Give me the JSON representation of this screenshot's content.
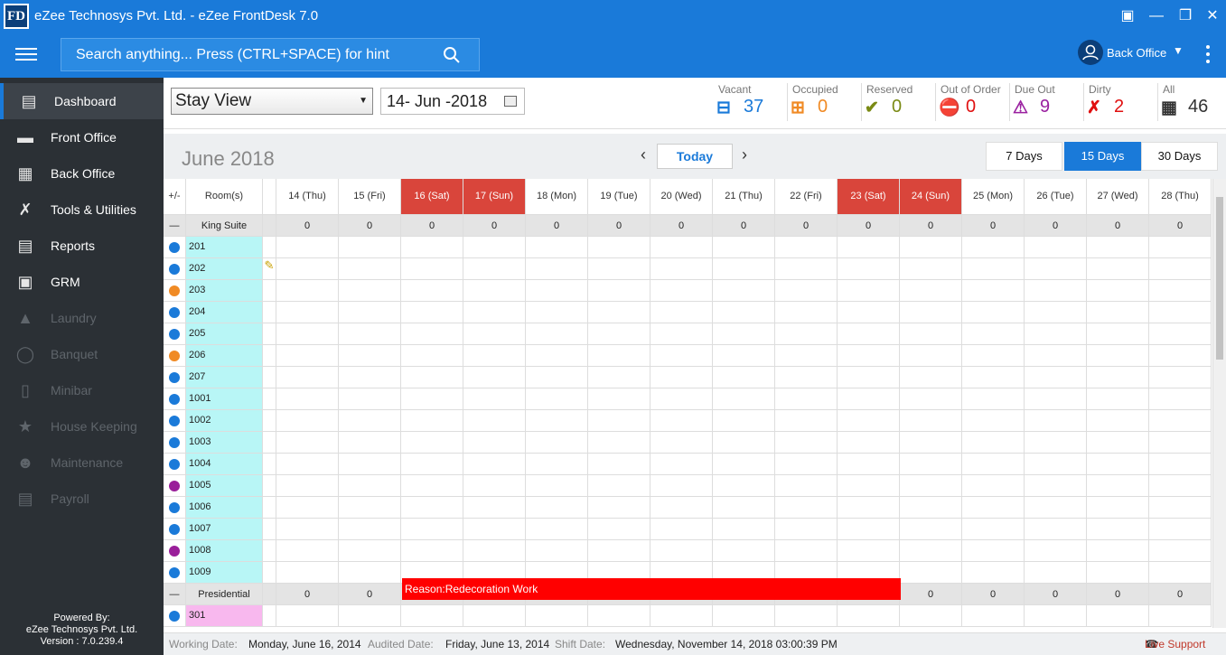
{
  "app": {
    "logo": "FD",
    "title": "eZee Technosys Pvt. Ltd. - eZee FrontDesk 7.0"
  },
  "search": {
    "placeholder": "Search anything... Press (CTRL+SPACE) for hint"
  },
  "user": {
    "name": "Back Office"
  },
  "sidebar": {
    "items": [
      {
        "label": "Dashboard",
        "icon": "chart-icon"
      },
      {
        "label": "Front Office",
        "icon": "bed-icon"
      },
      {
        "label": "Back Office",
        "icon": "building-icon"
      },
      {
        "label": "Tools & Utilities",
        "icon": "tools-icon"
      },
      {
        "label": "Reports",
        "icon": "report-icon"
      },
      {
        "label": "GRM",
        "icon": "grm-icon"
      },
      {
        "label": "Laundry",
        "icon": "iron-icon"
      },
      {
        "label": "Banquet",
        "icon": "banquet-icon"
      },
      {
        "label": "Minibar",
        "icon": "fridge-icon"
      },
      {
        "label": "House Keeping",
        "icon": "housekeeping-icon"
      },
      {
        "label": "Maintenance",
        "icon": "maintenance-icon"
      },
      {
        "label": "Payroll",
        "icon": "payroll-icon"
      }
    ],
    "powered": {
      "l1": "Powered By:",
      "l2": "eZee Technosys Pvt. Ltd.",
      "l3": "Version : 7.0.239.4"
    }
  },
  "controls": {
    "view": "Stay View",
    "date": "14- Jun -2018"
  },
  "stats": [
    {
      "label": "Vacant",
      "value": "37",
      "color": "#1a7ad9",
      "icon": "bed-icon"
    },
    {
      "label": "Occupied",
      "value": "0",
      "color": "#f08a24",
      "icon": "occupied-bed-icon"
    },
    {
      "label": "Reserved",
      "value": "0",
      "color": "#7a8a14",
      "icon": "reserved-icon"
    },
    {
      "label": "Out of Order",
      "value": "0",
      "color": "#e01010",
      "icon": "out-of-order-icon"
    },
    {
      "label": "Due Out",
      "value": "9",
      "color": "#9a20a0",
      "icon": "due-out-icon"
    },
    {
      "label": "Dirty",
      "value": "2",
      "color": "#e01010",
      "icon": "dirty-icon"
    },
    {
      "label": "All",
      "value": "46",
      "color": "#333",
      "icon": "building-icon"
    }
  ],
  "calendar": {
    "month": "June 2018",
    "today": "Today",
    "ranges": [
      "7 Days",
      "15 Days",
      "30 Days"
    ],
    "toggle_label": "+/-",
    "rooms_label": "Room(s)",
    "days": [
      "14 (Thu)",
      "15 (Fri)",
      "16 (Sat)",
      "17 (Sun)",
      "18 (Mon)",
      "19 (Tue)",
      "20 (Wed)",
      "21 (Thu)",
      "22 (Fri)",
      "23 (Sat)",
      "24 (Sun)",
      "25 (Mon)",
      "26 (Tue)",
      "27 (Wed)",
      "28 (Thu)"
    ],
    "weekend": [
      2,
      3,
      9,
      10
    ],
    "groups": [
      {
        "name": "King Suite",
        "counts": [
          "0",
          "0",
          "0",
          "0",
          "0",
          "0",
          "0",
          "0",
          "0",
          "0",
          "0",
          "0",
          "0",
          "0",
          "0"
        ],
        "rooms": [
          {
            "no": "201",
            "status": "blue"
          },
          {
            "no": "202",
            "status": "blue",
            "dirty": true
          },
          {
            "no": "203",
            "status": "orange"
          },
          {
            "no": "204",
            "status": "blue"
          },
          {
            "no": "205",
            "status": "blue"
          },
          {
            "no": "206",
            "status": "orange"
          },
          {
            "no": "207",
            "status": "blue"
          },
          {
            "no": "1001",
            "status": "blue"
          },
          {
            "no": "1002",
            "status": "blue"
          },
          {
            "no": "1003",
            "status": "blue"
          },
          {
            "no": "1004",
            "status": "blue"
          },
          {
            "no": "1005",
            "status": "purple"
          },
          {
            "no": "1006",
            "status": "blue"
          },
          {
            "no": "1007",
            "status": "blue"
          },
          {
            "no": "1008",
            "status": "purple"
          },
          {
            "no": "1009",
            "status": "blue"
          }
        ]
      },
      {
        "name": "Presidential",
        "counts": [
          "0",
          "0",
          "0",
          "0",
          "0",
          "0",
          "0",
          "0",
          "0",
          "0",
          "0",
          "0",
          "0",
          "0",
          "0"
        ],
        "rooms": [
          {
            "no": "301",
            "status": "blue"
          }
        ]
      }
    ],
    "block": {
      "text": "Reason:Redecoration Work",
      "room": "1005",
      "from": "16 (Sat)",
      "to": "23 (Sat)",
      "color": "#ff0000"
    }
  },
  "status": {
    "working_k": "Working Date:",
    "working_v": "Monday, June 16, 2014",
    "audited_k": "Audited Date:",
    "audited_v": "Friday, June 13, 2014",
    "shift_k": "Shift Date:",
    "shift_v": "Wednesday, November 14, 2018 03:00:39 PM",
    "support": "Live Support"
  },
  "colors": {
    "accent": "#1a7ad9",
    "sidebar": "#2b3035",
    "weekend": "#d9453b",
    "room_cell": "#b8f6f6",
    "room_cell_alt": "#f8b8ee"
  }
}
